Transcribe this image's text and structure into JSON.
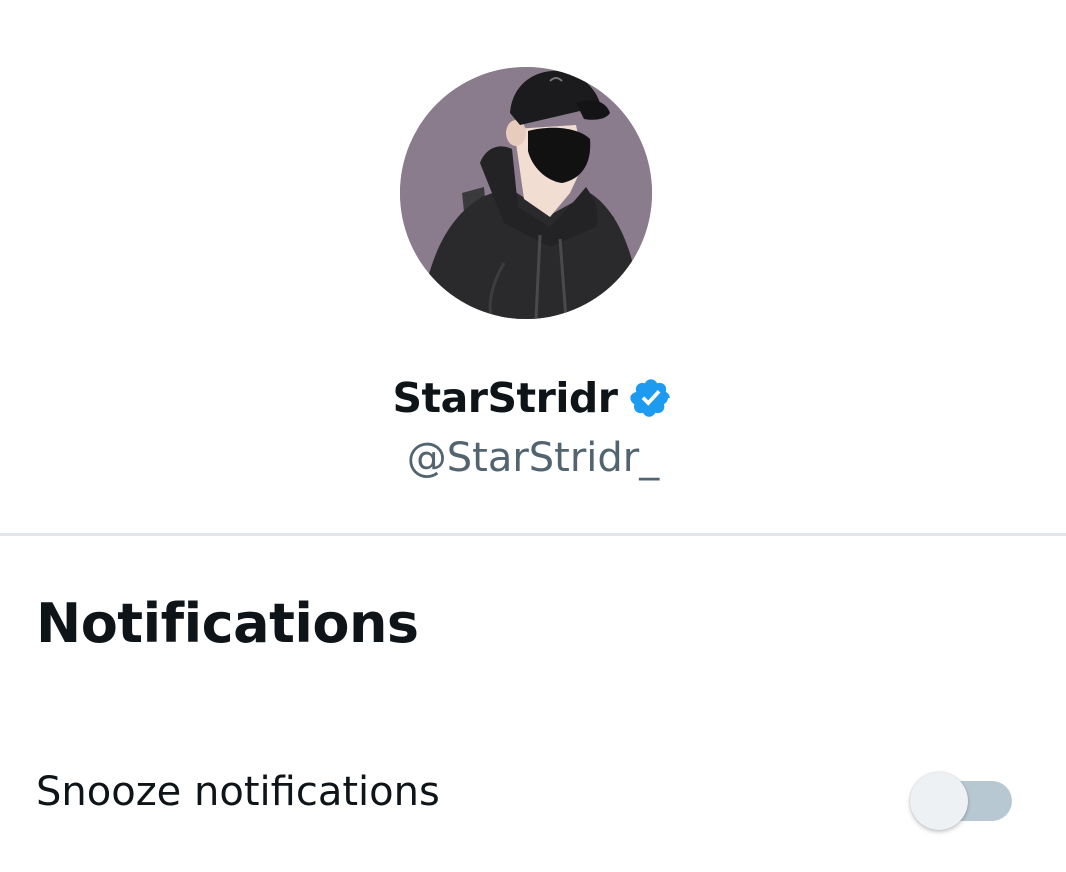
{
  "profile": {
    "display_name": "StarStridr",
    "handle": "@StarStridr_",
    "verified": true,
    "verified_color": "#1d9bf0",
    "avatar_background": "#8a7c8c"
  },
  "notifications": {
    "title": "Notifications",
    "snooze": {
      "label": "Snooze notifications",
      "enabled": false,
      "track_color": "#b8c8d3",
      "thumb_color": "#eef1f3"
    }
  }
}
